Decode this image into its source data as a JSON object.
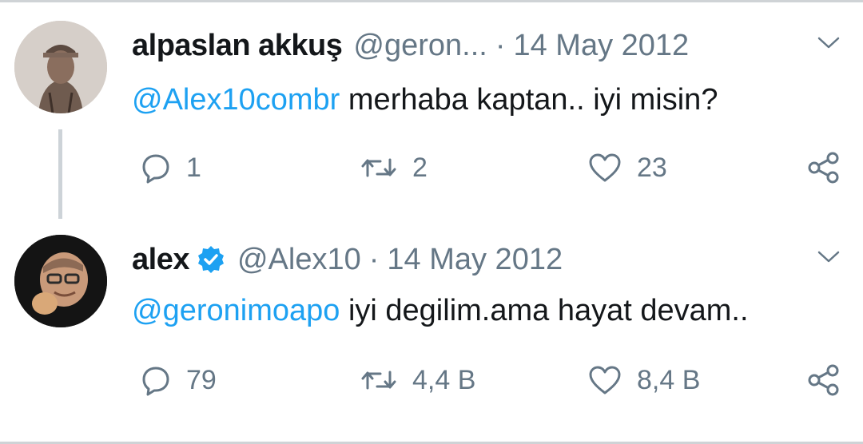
{
  "tweets": [
    {
      "name": "alpaslan akkuş",
      "handle": "@geron...",
      "separator": "·",
      "date": "14 May 2012",
      "mention": "@Alex10combr",
      "body": " merhaba kaptan.. iyi misin?",
      "replies": "1",
      "retweets": "2",
      "likes": "23",
      "verified": false
    },
    {
      "name": "alex",
      "handle": "@Alex10",
      "separator": "·",
      "date": "14 May 2012",
      "mention": "@geronimoapo",
      "body": " iyi degilim.ama hayat devam..",
      "replies": "79",
      "retweets": "4,4 B",
      "likes": "8,4 B",
      "verified": true
    }
  ],
  "colors": {
    "mention": "#1da1f2",
    "muted": "#657786",
    "verified": "#1da1f2"
  }
}
